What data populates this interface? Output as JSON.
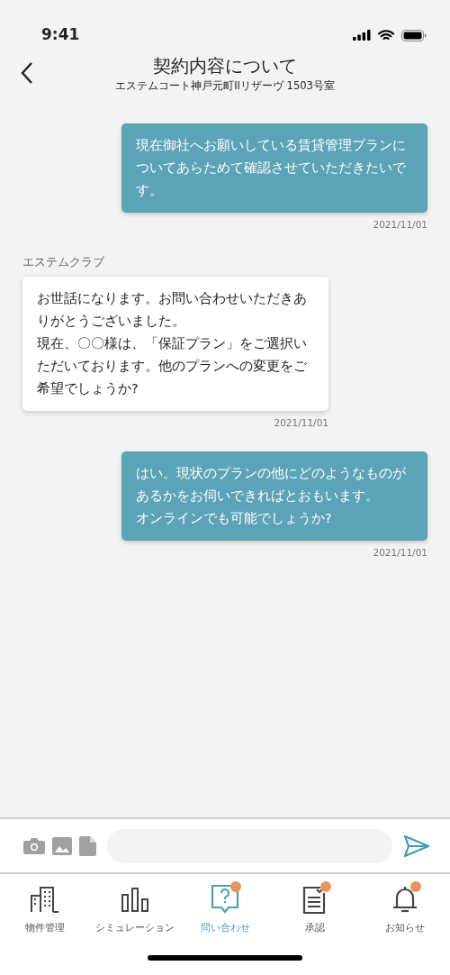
{
  "status_bar": {
    "time": "9:41"
  },
  "header": {
    "title": "契約内容について",
    "subtitle": "エステムコート神戸元町IIリザーヴ 1503号室"
  },
  "messages": [
    {
      "kind": "sent",
      "text": "現在御社へお願いしている賃貸管理プランについてあらためて確認させていただきたいです。",
      "date": "2021/11/01"
    },
    {
      "kind": "received",
      "sender": "エステムクラブ",
      "text": "お世話になります。お問い合わせいただきありがとうございました。",
      "text_2": "現在、〇〇様は、「保証プラン」をご選択いただいております。他のプランへの変更をご希望でしょうか?",
      "date": "2021/11/01"
    },
    {
      "kind": "sent",
      "text": "はい。現状のプランの他にどのようなものがあるかをお伺いできればとおもいます。",
      "text_2": "オンラインでも可能でしょうか?",
      "date": "2021/11/01"
    }
  ],
  "tabs": [
    {
      "label": "物件管理",
      "selected": false,
      "badge": false
    },
    {
      "label": "シミュレーション",
      "selected": false,
      "badge": false
    },
    {
      "label": "問い合わせ",
      "selected": true,
      "badge": true
    },
    {
      "label": "承認",
      "selected": false,
      "badge": true
    },
    {
      "label": "お知らせ",
      "selected": false,
      "badge": true
    }
  ]
}
